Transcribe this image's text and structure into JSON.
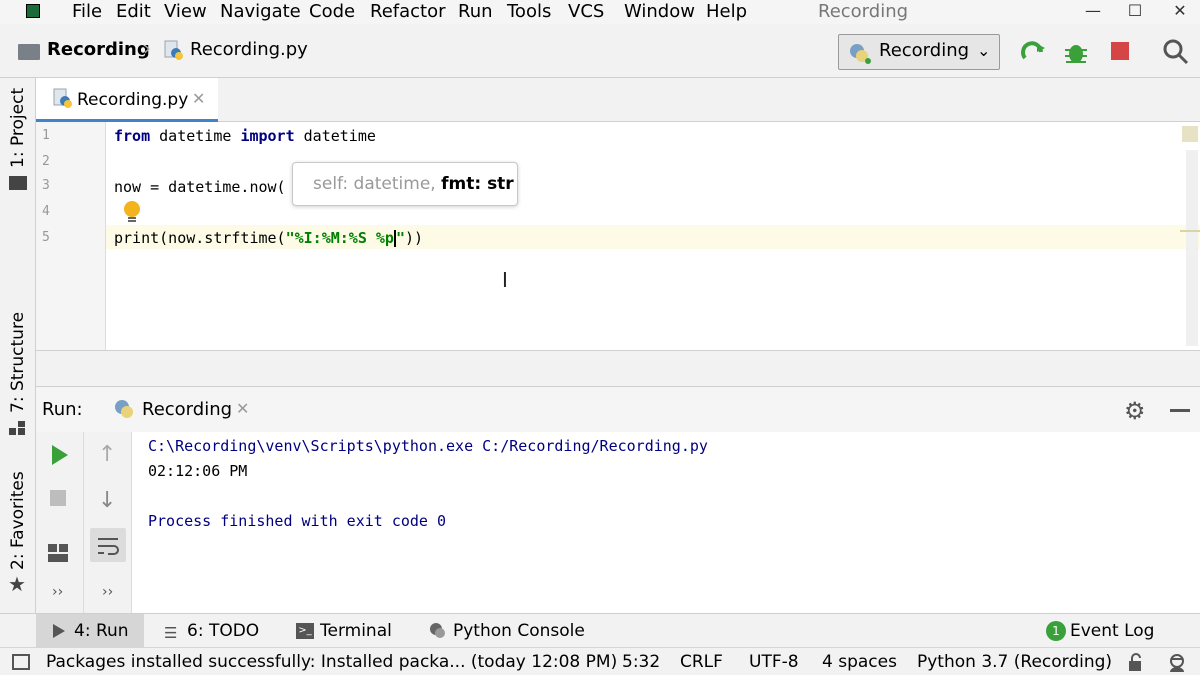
{
  "menu": {
    "items": [
      "File",
      "Edit",
      "View",
      "Navigate",
      "Code",
      "Refactor",
      "Run",
      "Tools",
      "VCS",
      "Window",
      "Help"
    ],
    "window_title": "Recording",
    "controls": [
      "—",
      "☐",
      "✕"
    ]
  },
  "navbar": {
    "project": "Recording",
    "file": "Recording.py",
    "run_config": "Recording"
  },
  "left_strip": {
    "project_tab": "1: Project",
    "structure_tab": "7: Structure",
    "favorites_tab": "2: Favorites"
  },
  "editor": {
    "tab_label": "Recording.py",
    "line_numbers": [
      "1",
      "2",
      "3",
      "4",
      "5"
    ],
    "line1": {
      "kw1": "from",
      "t1": " datetime ",
      "kw2": "import",
      "t2": " datetime"
    },
    "line3": {
      "t1": "now = datetime.now("
    },
    "line5": {
      "t1": "print(now.strftime(",
      "s1": "\"%I:%M:%S %p",
      "s2": "\"",
      "t2": "))"
    },
    "tooltip": {
      "param1": "self: datetime,",
      "param2": "fmt: str"
    }
  },
  "run_panel": {
    "label": "Run:",
    "tab": "Recording",
    "output": [
      "C:\\Recording\\venv\\Scripts\\python.exe C:/Recording/Recording.py",
      "02:12:06 PM",
      "",
      "Process finished with exit code 0"
    ]
  },
  "tool_windows": {
    "run": "4: Run",
    "todo": "6: TODO",
    "terminal": "Terminal",
    "python_console": "Python Console",
    "event_log": "Event Log",
    "event_count": "1"
  },
  "status": {
    "message": "Packages installed successfully: Installed packa... (today 12:08 PM)",
    "position": "5:32",
    "line_sep": "CRLF",
    "encoding": "UTF-8",
    "indent": "4 spaces",
    "interpreter": "Python 3.7 (Recording)"
  },
  "colors": {
    "keyword": "#000080",
    "string": "#008000",
    "run_green": "#3aa13a",
    "stop_red": "#d64545"
  }
}
